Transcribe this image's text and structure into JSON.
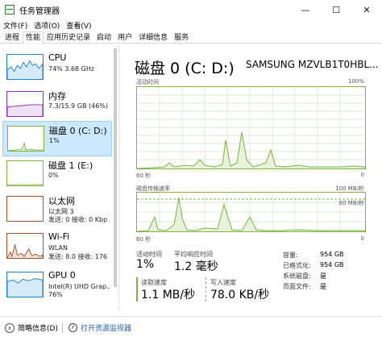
{
  "window": {
    "title": "任务管理器",
    "minimize": "—",
    "maximize": "☐",
    "close": "✕"
  },
  "menu": [
    "文件(F)",
    "选项(O)",
    "查看(V)"
  ],
  "tabs": [
    "进程",
    "性能",
    "应用历史记录",
    "启动",
    "用户",
    "详细信息",
    "服务"
  ],
  "active_tab": "性能",
  "sidebar": {
    "items": [
      {
        "name": "CPU",
        "line1": "74%  3.68 GHz",
        "line2": "",
        "color": "#1a83c6"
      },
      {
        "name": "内存",
        "line1": "7.3/15.9 GB (46%)",
        "line2": "",
        "color": "#8b2fae"
      },
      {
        "name": "磁盘 0 (C: D:)",
        "line1": "1%",
        "line2": "",
        "color": "#4caf50"
      },
      {
        "name": "磁盘 1 (E:)",
        "line1": "0%",
        "line2": "",
        "color": "#4caf50"
      },
      {
        "name": "以太网",
        "line1": "以太网 3",
        "line2": "发送: 0 接收: 0 Kbp",
        "color": "#a0522d"
      },
      {
        "name": "Wi-Fi",
        "line1": "WLAN",
        "line2": "发送: 8.0  接收: 176",
        "color": "#a0522d"
      },
      {
        "name": "GPU 0",
        "line1": "Intel(R) UHD Grap..",
        "line2": "76%",
        "color": "#1a83c6"
      }
    ]
  },
  "main": {
    "title": "磁盘 0 (C: D:)",
    "model": "SAMSUNG MZVLB1T0HBL...",
    "chart1": {
      "label_top_left": "活动时间",
      "label_top_right": "100%",
      "label_bottom_left": "60 秒",
      "label_bottom_right": "0"
    },
    "chart2": {
      "label_top_left": "磁盘传输速率",
      "label_top_right": "100 MB/秒",
      "label_inner_right": "60 MB/秒",
      "label_bottom_left": "60 秒",
      "label_bottom_right": "0"
    },
    "stats": {
      "active_time_label": "活动时间",
      "active_time_value": "1%",
      "avg_response_label": "平均响应时间",
      "avg_response_value": "1.2 毫秒",
      "read_label": "读取速度",
      "read_value": "1.1 MB/秒",
      "write_label": "写入速度",
      "write_value": "78.0 KB/秒"
    },
    "details": [
      {
        "key": "容量:",
        "value": "954 GB"
      },
      {
        "key": "已格式化:",
        "value": "954 GB"
      },
      {
        "key": "系统磁盘:",
        "value": "是"
      },
      {
        "key": "页面文件:",
        "value": "是"
      }
    ]
  },
  "footer": {
    "fewer_details": "简略信息(D)",
    "open_monitor": "打开资源监视器"
  },
  "colors": {
    "disk_green": "#7cb342",
    "selected_bg": "#cce8ff"
  }
}
